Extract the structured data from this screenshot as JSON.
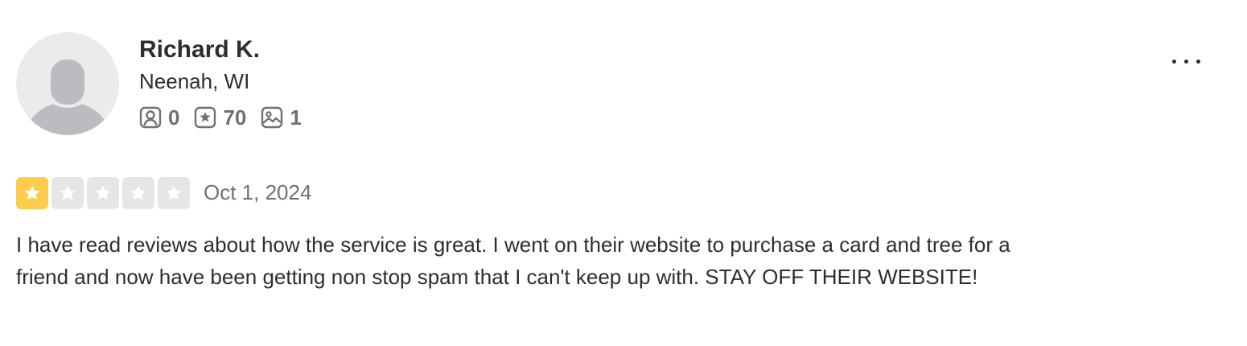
{
  "review": {
    "user": {
      "name": "Richard K.",
      "location": "Neenah, WI",
      "avatar_icon": "default-user-avatar-icon",
      "stats": {
        "friends": {
          "icon": "friends-icon",
          "value": "0"
        },
        "reviews": {
          "icon": "reviews-star-icon",
          "value": "70"
        },
        "photos": {
          "icon": "photo-icon",
          "value": "1"
        }
      }
    },
    "more_icon": "ellipsis-icon",
    "rating": {
      "value": 1,
      "max": 5,
      "filled_color": "#ffcc4b",
      "empty_color": "#e6e6e6"
    },
    "date": "Oct 1, 2024",
    "text": "I have read reviews about how the service is great. I went on their website to purchase a card and tree for a friend and now have been getting non stop spam that I can't keep up with. STAY OFF THEIR WEBSITE!"
  }
}
